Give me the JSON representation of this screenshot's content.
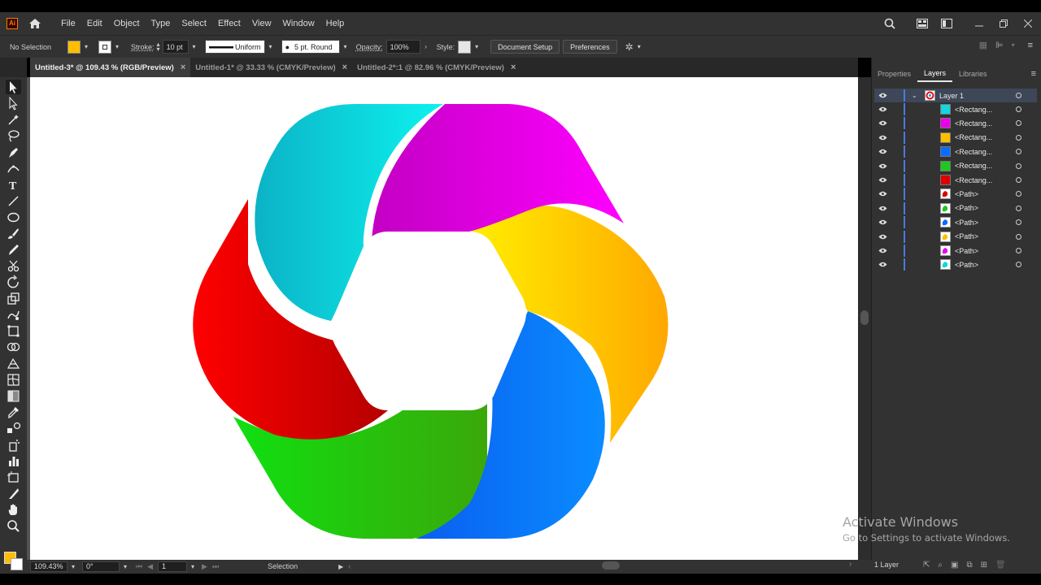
{
  "app": {
    "logo_text": "Ai",
    "menu": [
      "File",
      "Edit",
      "Object",
      "Type",
      "Select",
      "Effect",
      "View",
      "Window",
      "Help"
    ]
  },
  "control_bar": {
    "selection_label": "No Selection",
    "stroke_label": "Stroke:",
    "stroke_value": "10 pt",
    "profile_value": "Uniform",
    "brush_value": "5 pt. Round",
    "opacity_label": "Opacity:",
    "opacity_value": "100%",
    "style_label": "Style:",
    "document_setup": "Document Setup",
    "preferences": "Preferences",
    "fill_color": "#ffbe00"
  },
  "tabs": [
    {
      "label": "Untitled-3* @ 109.43 % (RGB/Preview)",
      "active": true
    },
    {
      "label": "Untitled-1* @ 33.33 % (CMYK/Preview)",
      "active": false
    },
    {
      "label": "Untitled-2*:1 @ 82.96 % (CMYK/Preview)",
      "active": false
    }
  ],
  "panel": {
    "tabs": [
      "Properties",
      "Layers",
      "Libraries"
    ],
    "active_tab": "Layers",
    "layer_name": "Layer 1",
    "items": [
      {
        "name": "<Rectang...",
        "color": "#11d7e0",
        "kind": "rect"
      },
      {
        "name": "<Rectang...",
        "color": "#ea00ea",
        "kind": "rect"
      },
      {
        "name": "<Rectang...",
        "color": "#ffbe00",
        "kind": "rect"
      },
      {
        "name": "<Rectang...",
        "color": "#0a6cff",
        "kind": "rect"
      },
      {
        "name": "<Rectang...",
        "color": "#1ec81e",
        "kind": "rect"
      },
      {
        "name": "<Rectang...",
        "color": "#dd0000",
        "kind": "rect"
      },
      {
        "name": "<Path>",
        "color": "#dd0000",
        "kind": "path"
      },
      {
        "name": "<Path>",
        "color": "#1ec81e",
        "kind": "path"
      },
      {
        "name": "<Path>",
        "color": "#0a6cff",
        "kind": "path"
      },
      {
        "name": "<Path>",
        "color": "#ffbe00",
        "kind": "path"
      },
      {
        "name": "<Path>",
        "color": "#ea00ea",
        "kind": "path"
      },
      {
        "name": "<Path>",
        "color": "#11d7e0",
        "kind": "path"
      }
    ],
    "layer_count": "1 Layer"
  },
  "status": {
    "zoom": "109.43%",
    "rotation": "0°",
    "artboard": "1",
    "tool": "Selection"
  },
  "watermark": {
    "line1": "Activate Windows",
    "line2": "Go to Settings to activate Windows."
  }
}
